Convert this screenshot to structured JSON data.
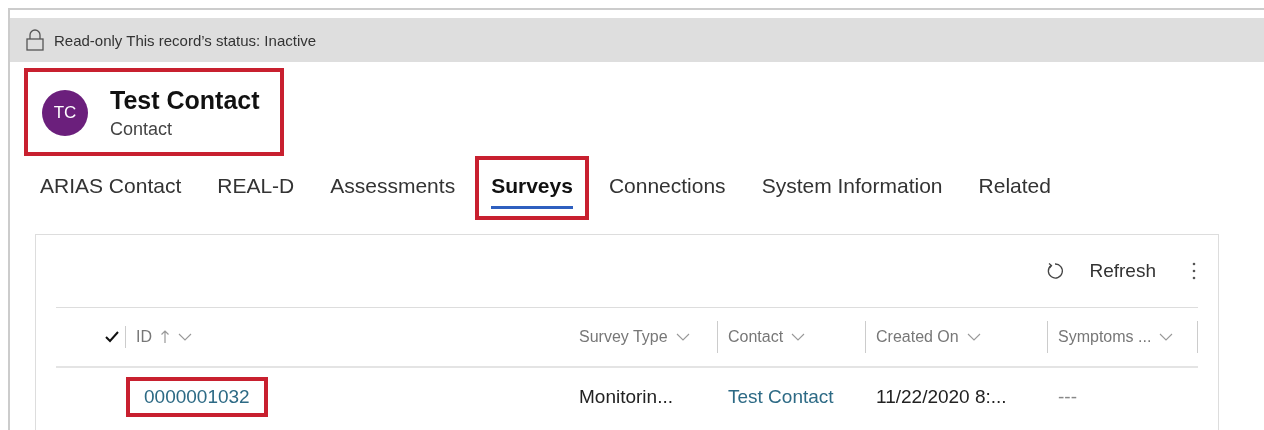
{
  "notice": {
    "text": "Read-only This record’s status: Inactive"
  },
  "header": {
    "initials": "TC",
    "title": "Test Contact",
    "subtitle": "Contact",
    "highlighted": true
  },
  "tabs": [
    {
      "label": "ARIAS Contact",
      "selected": false,
      "highlighted": false
    },
    {
      "label": "REAL-D",
      "selected": false,
      "highlighted": false
    },
    {
      "label": "Assessments",
      "selected": false,
      "highlighted": false
    },
    {
      "label": "Surveys",
      "selected": true,
      "highlighted": true
    },
    {
      "label": "Connections",
      "selected": false,
      "highlighted": false
    },
    {
      "label": "System Information",
      "selected": false,
      "highlighted": false
    },
    {
      "label": "Related",
      "selected": false,
      "highlighted": false
    }
  ],
  "toolbar": {
    "refresh": "Refresh"
  },
  "table": {
    "all_selected": true,
    "columns": [
      {
        "label": "ID",
        "sorted": true
      },
      {
        "label": "Survey Type",
        "sorted": false
      },
      {
        "label": "Contact",
        "sorted": false
      },
      {
        "label": "Created On",
        "sorted": false
      },
      {
        "label": "Symptoms ...",
        "sorted": false
      }
    ],
    "rows": [
      {
        "cells": [
          {
            "text": "0000001032",
            "kind": "link",
            "highlighted": true
          },
          {
            "text": "Monitorin...",
            "kind": "text",
            "highlighted": false
          },
          {
            "text": "Test Contact",
            "kind": "link",
            "highlighted": false
          },
          {
            "text": "11/22/2020 8:...",
            "kind": "text",
            "highlighted": false
          },
          {
            "text": "---",
            "kind": "muted",
            "highlighted": false
          }
        ]
      }
    ]
  }
}
